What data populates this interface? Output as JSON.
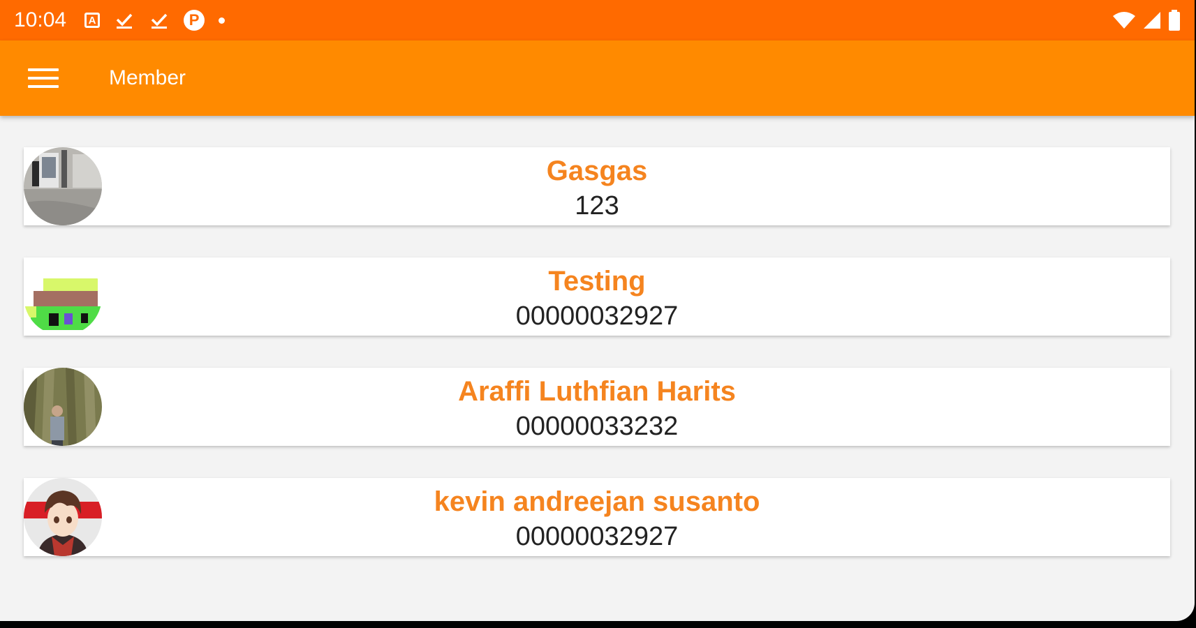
{
  "status_bar": {
    "time": "10:04",
    "left_icons": [
      "notification-a-icon",
      "download-done-icon",
      "download-done-icon",
      "app-p-icon",
      "dot-icon"
    ],
    "right_icons": [
      "wifi-icon",
      "signal-icon",
      "battery-icon"
    ]
  },
  "app_bar": {
    "title": "Member",
    "menu_icon": "hamburger-menu-icon"
  },
  "members": [
    {
      "name": "Gasgas",
      "id": "123"
    },
    {
      "name": "Testing",
      "id": "00000032927"
    },
    {
      "name": "Araffi Luthfian Harits",
      "id": "00000033232"
    },
    {
      "name": "kevin andreejan susanto",
      "id": "00000032927"
    }
  ],
  "colors": {
    "status_bar": "#ff6a00",
    "app_bar": "#ff8a00",
    "member_name": "#f5841f",
    "background": "#f3f3f3"
  }
}
